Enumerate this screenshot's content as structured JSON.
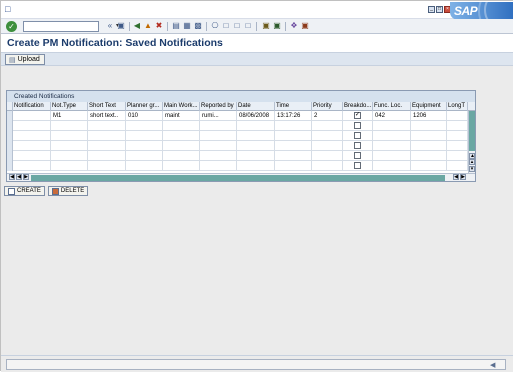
{
  "window": {
    "menu_icon": "sap-menu-icon",
    "controls": [
      "minimize",
      "restore",
      "close"
    ]
  },
  "brand": {
    "logo_text": "SAP"
  },
  "toolbar": {
    "command_field_value": "",
    "icons": [
      "check-icon",
      "save-icon",
      "back-icon",
      "exit-icon",
      "cancel-icon",
      "print-icon",
      "find-icon",
      "find-next-icon",
      "first-page-icon",
      "prev-page-icon",
      "next-page-icon",
      "last-page-icon",
      "new-session-icon",
      "shortcut-icon",
      "help-icon",
      "layout-icon"
    ]
  },
  "title": {
    "text": "Create PM Notification: Saved Notifications"
  },
  "app_toolbar": {
    "upload_label": "Upload"
  },
  "table": {
    "title": "Created Notifications",
    "columns": [
      "Notification",
      "Not.Type",
      "Short Text",
      "Planner gr...",
      "Main Work...",
      "Reported by",
      "Date",
      "Time",
      "Priority",
      "Breakdo...",
      "Func. Loc.",
      "Equipment",
      "LongT"
    ],
    "rows": [
      [
        "",
        "M1",
        "short text..",
        "010",
        "maint",
        "rumi...",
        "08/06/2008",
        "13:17:26",
        "2",
        "checked",
        "042",
        "1206",
        ""
      ],
      [
        "",
        "",
        "",
        "",
        "",
        "",
        "",
        "",
        "",
        "unchecked",
        "",
        "",
        ""
      ],
      [
        "",
        "",
        "",
        "",
        "",
        "",
        "",
        "",
        "",
        "unchecked",
        "",
        "",
        ""
      ],
      [
        "",
        "",
        "",
        "",
        "",
        "",
        "",
        "",
        "",
        "unchecked",
        "",
        "",
        ""
      ],
      [
        "",
        "",
        "",
        "",
        "",
        "",
        "",
        "",
        "",
        "unchecked",
        "",
        "",
        ""
      ],
      [
        "",
        "",
        "",
        "",
        "",
        "",
        "",
        "",
        "",
        "unchecked",
        "",
        "",
        ""
      ]
    ]
  },
  "buttons": {
    "create_label": "CREATE",
    "delete_label": "DELETE"
  },
  "status": {
    "text": ""
  }
}
